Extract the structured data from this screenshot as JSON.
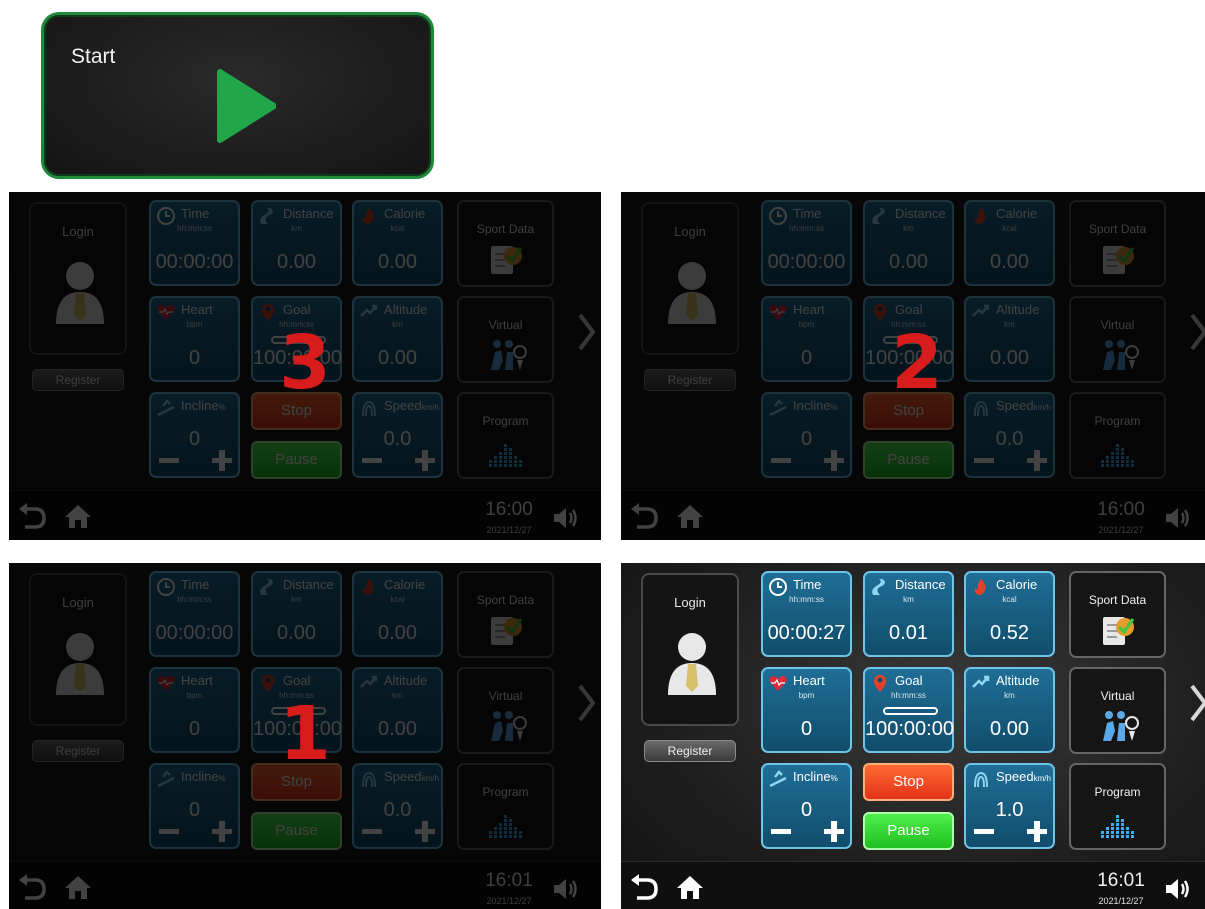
{
  "start": {
    "label": "Start"
  },
  "panel": {
    "login": "Login",
    "register": "Register",
    "tiles": {
      "time": {
        "title": "Time",
        "unit": "hh:mm:ss"
      },
      "distance": {
        "title": "Distance",
        "unit": "km"
      },
      "calorie": {
        "title": "Calorie",
        "unit": "kcal"
      },
      "heart": {
        "title": "Heart",
        "unit": "bpm"
      },
      "goal": {
        "title": "Goal",
        "unit": "hh:mm:ss"
      },
      "altitude": {
        "title": "Altitude",
        "unit": "km"
      },
      "incline": {
        "title": "Incline",
        "unit": "%"
      },
      "speed": {
        "title": "Speed",
        "unit": "km/h"
      }
    },
    "stop": "Stop",
    "pause": "Pause",
    "side": {
      "sport_data": "Sport Data",
      "virtual": "Virtual",
      "program": "Program"
    }
  },
  "countdown": {
    "p1": "3",
    "p2": "2",
    "p3": "1"
  },
  "states": {
    "p1": {
      "time": "00:00:00",
      "distance": "0.00",
      "calorie": "0.00",
      "heart": "0",
      "goal": "100:00:00",
      "altitude": "0.00",
      "incline": "0",
      "speed": "0.0",
      "clock": "16:00",
      "date": "2021/12/27"
    },
    "p2": {
      "time": "00:00:00",
      "distance": "0.00",
      "calorie": "0.00",
      "heart": "0",
      "goal": "100:00:00",
      "altitude": "0.00",
      "incline": "0",
      "speed": "0.0",
      "clock": "16:00",
      "date": "2021/12/27"
    },
    "p3": {
      "time": "00:00:00",
      "distance": "0.00",
      "calorie": "0.00",
      "heart": "0",
      "goal": "100:00:00",
      "altitude": "0.00",
      "incline": "0",
      "speed": "0.0",
      "clock": "16:01",
      "date": "2021/12/27"
    },
    "p4": {
      "time": "00:00:27",
      "distance": "0.01",
      "calorie": "0.52",
      "heart": "0",
      "goal": "100:00:00",
      "altitude": "0.00",
      "incline": "0",
      "speed": "1.0",
      "clock": "16:01",
      "date": "2021/12/27"
    }
  },
  "colors": {
    "tile": "#1f6e96",
    "tile_border": "#6fc3e6",
    "stop": "#ff6a30",
    "pause": "#4df04a",
    "countdown": "#d81c1c",
    "start_border": "#1f8a3a",
    "play": "#22a64a"
  },
  "icons": [
    "play-icon",
    "avatar-icon",
    "clock-icon",
    "distance-icon",
    "calorie-icon",
    "heart-icon",
    "goal-icon",
    "altitude-icon",
    "incline-icon",
    "speed-icon",
    "sport-data-icon",
    "virtual-icon",
    "program-icon",
    "chevron-right-icon",
    "back-icon",
    "home-icon",
    "volume-icon"
  ]
}
